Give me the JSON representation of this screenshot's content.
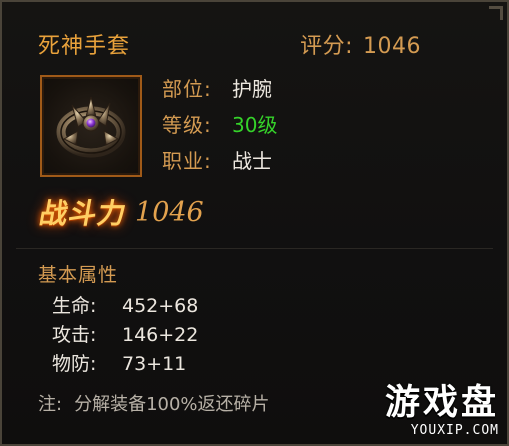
{
  "item": {
    "name": "死神手套",
    "score_label": "评分:",
    "score_value": "1046",
    "icon": "gauntlet-ring-icon"
  },
  "info": [
    {
      "label": "部位:",
      "value": "护腕"
    },
    {
      "label": "等级:",
      "value": "30级",
      "value_color": "#35d22a"
    },
    {
      "label": "职业:",
      "value": "战士"
    }
  ],
  "power": {
    "label": "战斗力",
    "value": "1046"
  },
  "attributes": {
    "title": "基本属性",
    "rows": [
      {
        "name": "生命:",
        "value": "452+68"
      },
      {
        "name": "攻击:",
        "value": "146+22"
      },
      {
        "name": "物防:",
        "value": "73+11"
      }
    ]
  },
  "note": {
    "prefix": "注:",
    "text": "分解装备100%返还碎片"
  },
  "watermark": {
    "main": "游戏盘",
    "sub": "YOUXIP.COM"
  },
  "colors": {
    "title": "#e9a23b",
    "label": "#d49b52",
    "value": "#ece7df",
    "level_green": "#35d22a",
    "icon_border": "#a05a18"
  }
}
